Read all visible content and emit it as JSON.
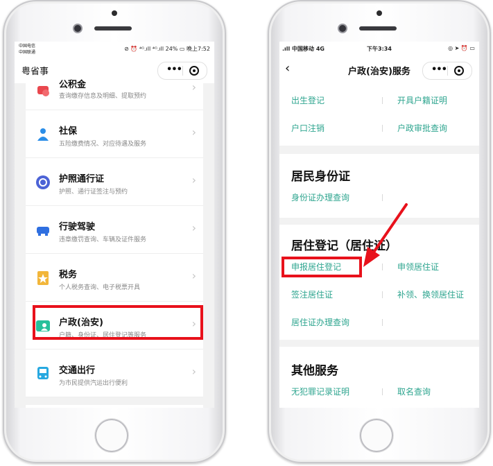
{
  "left_phone": {
    "status": {
      "carrier_1": "中国电信",
      "carrier_2": "中国联通",
      "right": "⊘ ⏰ ⁴ᴳ.ıll ⁴ᴳ.ıll 24% ▭ 晚上7:52"
    },
    "app_title": "粤省事",
    "services": [
      {
        "title": "公积金",
        "subtitle": "查询缴存信息及明细、提取预约",
        "icon": "fund-icon",
        "color": "#e9474e"
      },
      {
        "title": "社保",
        "subtitle": "五险缴费情况、对应待遇及服务",
        "icon": "social-security-icon",
        "color": "#2b8ee8"
      },
      {
        "title": "护照通行证",
        "subtitle": "护照、通行证签注与预约",
        "icon": "passport-icon",
        "color": "#4c63d6"
      },
      {
        "title": "行驶驾驶",
        "subtitle": "违章缴罚查询、车辆及证件服务",
        "icon": "car-icon",
        "color": "#2f6fe0"
      },
      {
        "title": "税务",
        "subtitle": "个人税务查询、电子税票开具",
        "icon": "tax-icon",
        "color": "#f2b63a"
      },
      {
        "title": "户政(治安)",
        "subtitle": "户籍、身份证、居住登记等服务",
        "icon": "household-icon",
        "color": "#27c09b"
      },
      {
        "title": "交通出行",
        "subtitle": "为市民提供汽运出行便利",
        "icon": "bus-icon",
        "color": "#27a8e0"
      }
    ]
  },
  "right_phone": {
    "status": {
      "carrier": ".ıll 中国移动  4G",
      "time": "下午3:34",
      "right": "◎ ➤ ⏰ ▭"
    },
    "page_title": "户政(治安)服务",
    "top_links": [
      "出生登记",
      "开具户籍证明",
      "户口注销",
      "户政审批查询"
    ],
    "id_section": {
      "title": "居民身份证",
      "links": [
        "身份证办理查询"
      ]
    },
    "residence_section": {
      "title": "居住登记（居住证）",
      "links": [
        "申报居住登记",
        "申领居住证",
        "签注居住证",
        "补领、换领居住证",
        "居住证办理查询"
      ]
    },
    "other_section": {
      "title": "其他服务",
      "links": [
        "无犯罪记录证明",
        "取名查询"
      ]
    }
  },
  "colors": {
    "accent_link": "#2ea58f",
    "highlight": "#e8111b"
  }
}
